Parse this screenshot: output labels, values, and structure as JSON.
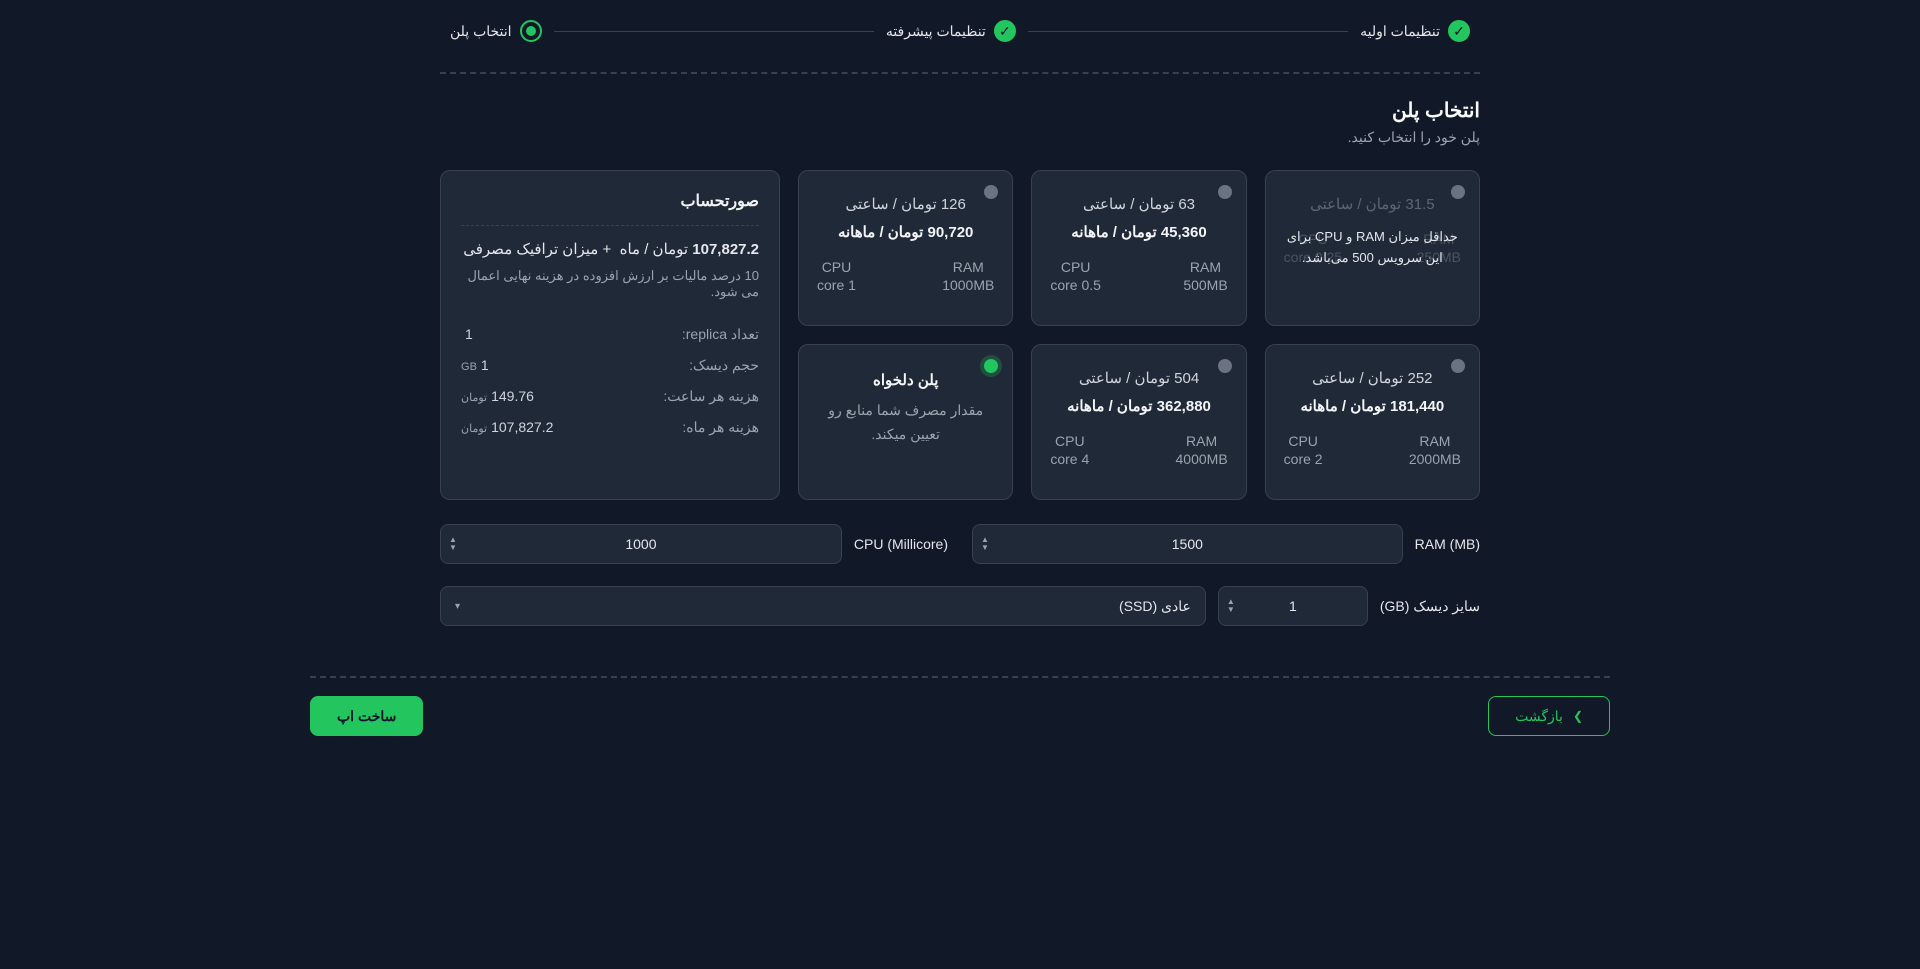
{
  "stepper": {
    "steps": [
      {
        "label": "تنظیمات اولیه",
        "state": "done"
      },
      {
        "label": "تنظیمات پیشرفته",
        "state": "done"
      },
      {
        "label": "انتخاب پلن",
        "state": "current"
      }
    ]
  },
  "section": {
    "title": "انتخاب پلن",
    "sub": "پلن خود را انتخاب کنید."
  },
  "plans": [
    {
      "hourly": "31.5 تومان / ساعتی",
      "monthly": "",
      "cpuLabel": "CPU",
      "cpuVal": "0.25 core",
      "ramLabel": "RAM",
      "ramVal": "250MB",
      "disabled": true,
      "overlay": "حداقل میزان RAM و CPU برای این سرویس 500 می‌باشد."
    },
    {
      "hourly": "63 تومان / ساعتی",
      "monthly": "45,360 تومان / ماهانه",
      "cpuLabel": "CPU",
      "cpuVal": "0.5 core",
      "ramLabel": "RAM",
      "ramVal": "500MB"
    },
    {
      "hourly": "126 تومان / ساعتی",
      "monthly": "90,720 تومان / ماهانه",
      "cpuLabel": "CPU",
      "cpuVal": "1 core",
      "ramLabel": "RAM",
      "ramVal": "1000MB"
    },
    {
      "hourly": "252 تومان / ساعتی",
      "monthly": "181,440 تومان / ماهانه",
      "cpuLabel": "CPU",
      "cpuVal": "2 core",
      "ramLabel": "RAM",
      "ramVal": "2000MB"
    },
    {
      "hourly": "504 تومان / ساعتی",
      "monthly": "362,880 تومان / ماهانه",
      "cpuLabel": "CPU",
      "cpuVal": "4 core",
      "ramLabel": "RAM",
      "ramVal": "4000MB"
    }
  ],
  "customPlan": {
    "title": "پلن دلخواه",
    "desc": "مقدار مصرف شما منابع رو تعیین میکند.",
    "selected": true
  },
  "invoice": {
    "title": "صورتحساب",
    "mainValue": "107,827.2",
    "mainSuffix": "تومان / ماه",
    "trafficLabel": "+ میزان ترافیک مصرفی",
    "note": "10 درصد مالیات بر ارزش افزوده در هزینه نهایی اعمال می شود.",
    "rows": [
      {
        "label": "تعداد replica:",
        "value": "1",
        "unit": ""
      },
      {
        "label": "حجم دیسک:",
        "value": "1",
        "unit": "GB"
      },
      {
        "label": "هزینه هر ساعت:",
        "value": "149.76",
        "unit": "تومان"
      },
      {
        "label": "هزینه هر ماه:",
        "value": "107,827.2",
        "unit": "تومان"
      }
    ]
  },
  "inputs": {
    "ramLabel": "RAM (MB)",
    "ramValue": "1500",
    "cpuLabel": "CPU (Millicore)",
    "cpuValue": "1000",
    "diskLabel": "سایز دیسک (GB)",
    "diskValue": "1",
    "diskTypeLabel": "عادی (SSD)"
  },
  "footer": {
    "back": "بازگشت",
    "submit": "ساخت اپ"
  }
}
